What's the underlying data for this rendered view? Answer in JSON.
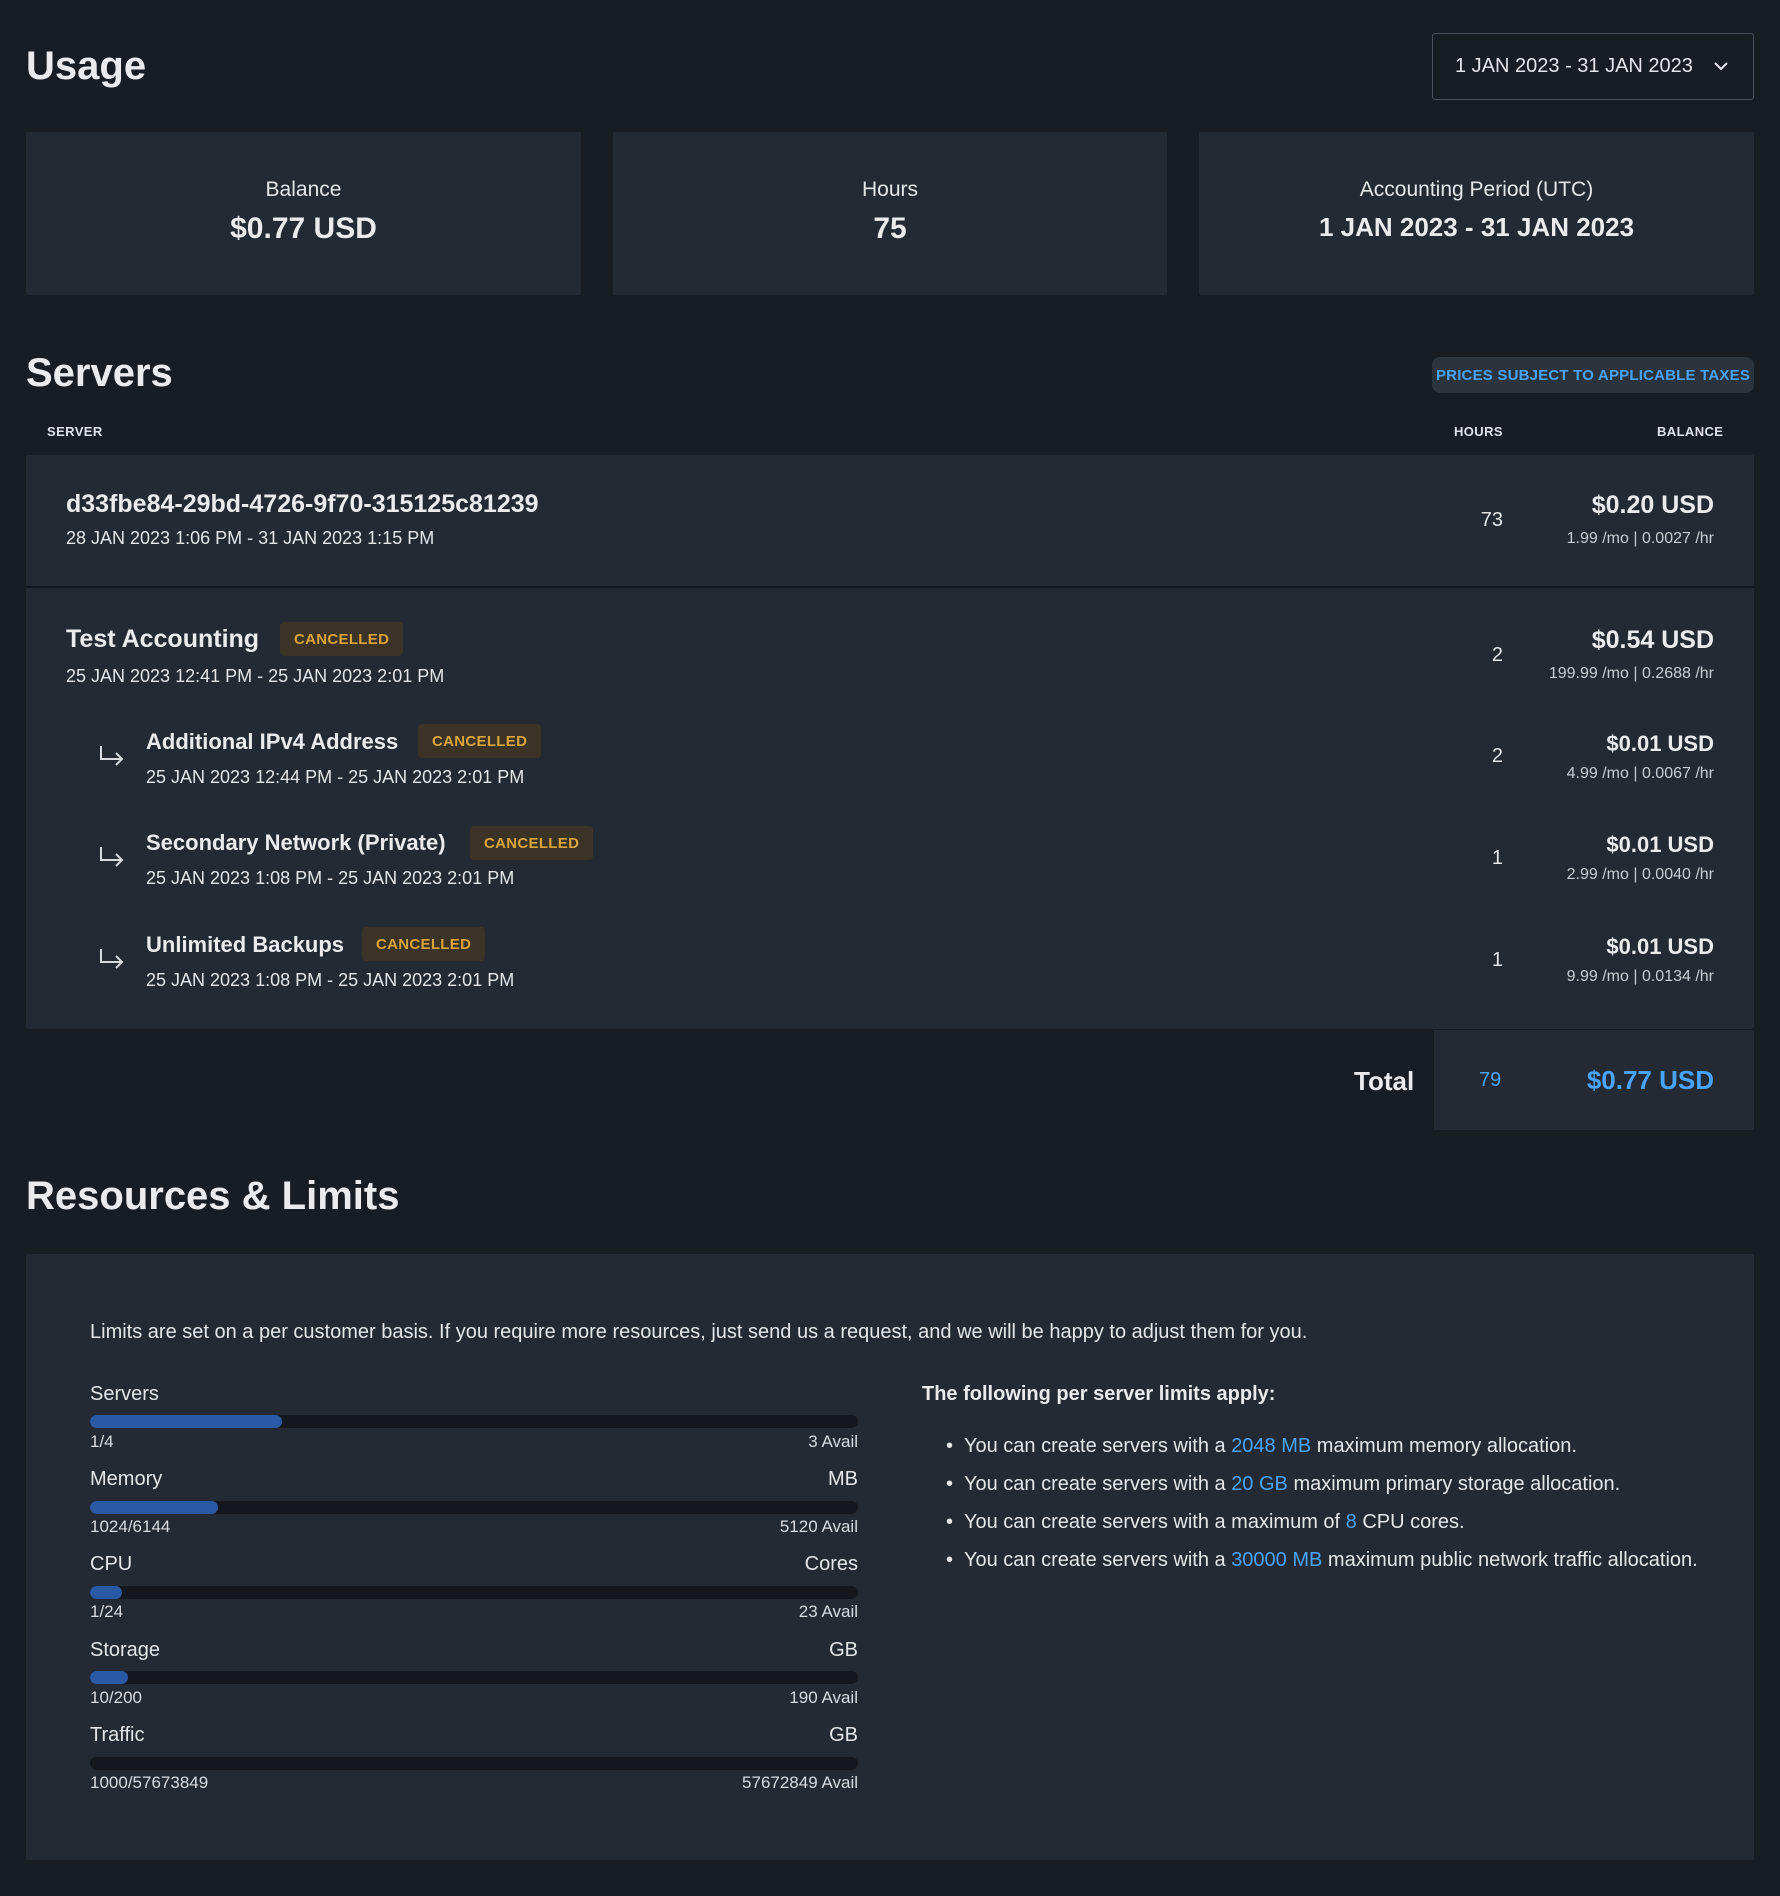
{
  "usage": {
    "title": "Usage",
    "date_range": "1 JAN 2023 - 31 JAN 2023",
    "stats": [
      {
        "label": "Balance",
        "value": "$0.77 USD"
      },
      {
        "label": "Hours",
        "value": "75"
      },
      {
        "label": "Accounting Period (UTC)",
        "value": "1 JAN 2023 - 31 JAN 2023"
      }
    ]
  },
  "servers": {
    "title": "Servers",
    "tax_note": "PRICES SUBJECT TO APPLICABLE TAXES",
    "columns": {
      "server": "SERVER",
      "hours": "HOURS",
      "balance": "BALANCE"
    },
    "rows": [
      {
        "name": "d33fbe84-29bd-4726-9f70-315125c81239",
        "dates": "28 JAN 2023 1:06 PM - 31 JAN 2023 1:15 PM",
        "hours": "73",
        "balance": "$0.20 USD",
        "rate": "1.99 /mo | 0.0027 /hr"
      },
      {
        "name": "Test Accounting",
        "status": "CANCELLED",
        "dates": "25 JAN 2023 12:41 PM - 25 JAN 2023 2:01 PM",
        "hours": "2",
        "balance": "$0.54 USD",
        "rate": "199.99 /mo | 0.2688 /hr"
      },
      {
        "name": "Additional IPv4 Address",
        "status": "CANCELLED",
        "dates": "25 JAN 2023 12:44 PM - 25 JAN 2023 2:01 PM",
        "hours": "2",
        "balance": "$0.01 USD",
        "rate": "4.99 /mo | 0.0067 /hr"
      },
      {
        "name": "Secondary Network (Private)",
        "status": "CANCELLED",
        "dates": "25 JAN 2023 1:08 PM - 25 JAN 2023 2:01 PM",
        "hours": "1",
        "balance": "$0.01 USD",
        "rate": "2.99 /mo | 0.0040 /hr"
      },
      {
        "name": "Unlimited Backups",
        "status": "CANCELLED",
        "dates": "25 JAN 2023 1:08 PM - 25 JAN 2023 2:01 PM",
        "hours": "1",
        "balance": "$0.01 USD",
        "rate": "9.99 /mo | 0.0134 /hr"
      }
    ],
    "total": {
      "label": "Total",
      "hours": "79",
      "balance": "$0.77 USD"
    }
  },
  "resources": {
    "title": "Resources & Limits",
    "intro": "Limits are set on a per customer basis. If you require more resources, just send us a request, and we will be happy to adjust them for you.",
    "items": [
      {
        "name": "Servers",
        "unit": "",
        "used": "1/4",
        "avail": "3 Avail",
        "fraction": 0.25
      },
      {
        "name": "Memory",
        "unit": "MB",
        "used": "1024/6144",
        "avail": "5120 Avail",
        "fraction": 0.1667
      },
      {
        "name": "CPU",
        "unit": "Cores",
        "used": "1/24",
        "avail": "23 Avail",
        "fraction": 0.0417
      },
      {
        "name": "Storage",
        "unit": "GB",
        "used": "10/200",
        "avail": "190 Avail",
        "fraction": 0.05
      },
      {
        "name": "Traffic",
        "unit": "GB",
        "used": "1000/57673849",
        "avail": "57672849 Avail",
        "fraction": 2e-05
      }
    ],
    "per_server_heading": "The following per server limits apply:",
    "per_server": [
      {
        "pre": "You can create servers with a ",
        "hl": "2048 MB",
        "post": " maximum memory allocation."
      },
      {
        "pre": "You can create servers with a ",
        "hl": "20 GB",
        "post": " maximum primary storage allocation."
      },
      {
        "pre": "You can create servers with a maximum of ",
        "hl": "8",
        "post": " CPU cores."
      },
      {
        "pre": "You can create servers with a ",
        "hl": "30000 MB",
        "post": " maximum public network traffic allocation."
      }
    ]
  },
  "colors": {
    "accent": "#4aa3ff",
    "bar": "#2a5aa6",
    "cancelled": "#d9a53a"
  }
}
